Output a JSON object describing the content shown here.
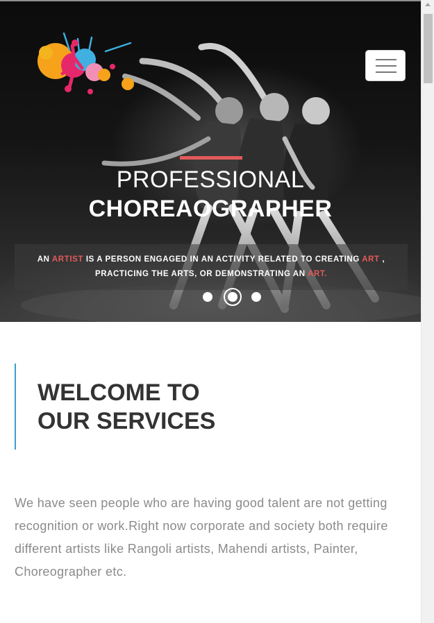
{
  "hero": {
    "title_line1": "PROFESSIONAL",
    "title_line2": "CHOREAOGRAPHER",
    "caption": {
      "part1": "AN ",
      "hl1": "ARTIST",
      "part2": " IS A PERSON ENGAGED IN AN ACTIVITY RELATED TO CREATING ",
      "hl2": "ART",
      "part3": " , PRACTICING THE ARTS, OR DEMONSTRATING AN ",
      "hl3": "ART",
      "part4": "."
    },
    "slides": {
      "count": 3,
      "active_index": 1
    },
    "accent_color": "#e25a5a"
  },
  "nav": {
    "menu_icon": "hamburger-menu-icon"
  },
  "logo": {
    "icon": "paint-splash-dancer-logo"
  },
  "welcome": {
    "heading_line1": "WELCOME TO",
    "heading_line2": "OUR SERVICES",
    "accent_color": "#3aa0c8",
    "text": "We have seen people who are having good talent are not getting recognition or work.Right now corporate and society both require different artists like Rangoli artists, Mahendi artists, Painter, Choreographer etc."
  }
}
